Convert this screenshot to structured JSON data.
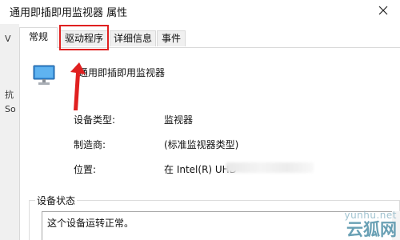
{
  "window": {
    "title": "通用即插即用监视器 属性",
    "close_label": "×"
  },
  "tabs": [
    {
      "label": "常规",
      "active": true
    },
    {
      "label": "驱动程序",
      "active": false,
      "highlighted": true
    },
    {
      "label": "详细信息",
      "active": false
    },
    {
      "label": "事件",
      "active": false
    }
  ],
  "left_strip_fragments": [
    "V",
    "抗",
    "So"
  ],
  "device": {
    "icon": "monitor-icon",
    "name": "通用即插即用监视器"
  },
  "properties": [
    {
      "label": "设备类型:",
      "value": "监视器"
    },
    {
      "label": "制造商:",
      "value": "(标准监视器类型)"
    },
    {
      "label": "位置:",
      "value": "在 Intel(R) UHD"
    }
  ],
  "status": {
    "group_label": "设备状态",
    "text": "这个设备运转正常。"
  },
  "annotation": {
    "color": "#e02020"
  },
  "watermark": {
    "url": "yunhu.net",
    "text": "云狐网"
  }
}
